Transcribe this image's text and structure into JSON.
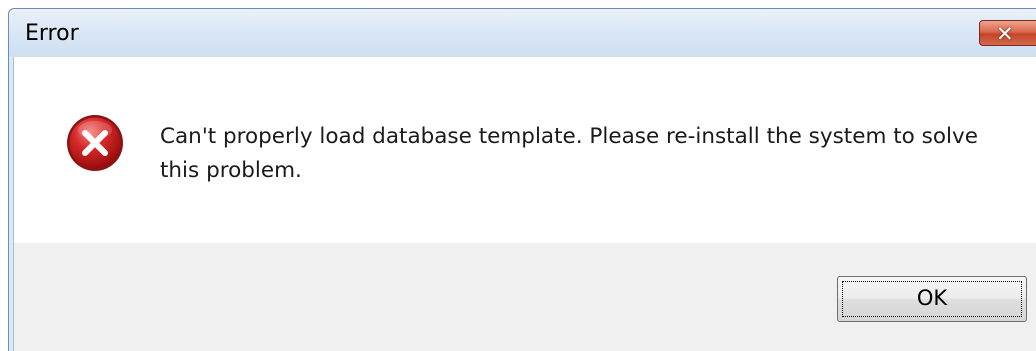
{
  "window": {
    "title": "Error",
    "close_glyph": "✕"
  },
  "message": {
    "icon": "error-icon",
    "text": "Can't properly load database template. Please re-install the system to solve this problem."
  },
  "buttons": {
    "ok_label": "OK"
  },
  "colors": {
    "error_red": "#c8161d",
    "close_red": "#c2452a",
    "titlebar": "#dae7f5"
  }
}
